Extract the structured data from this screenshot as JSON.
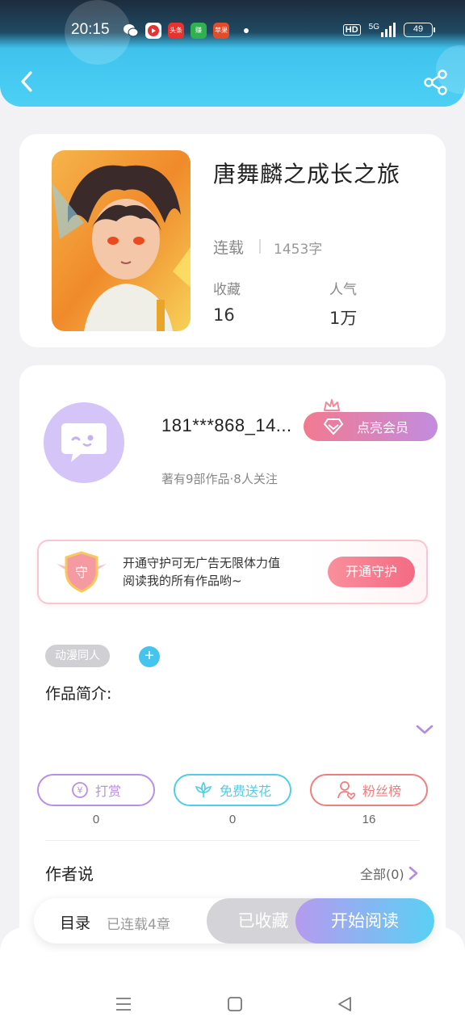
{
  "status_bar": {
    "time": "20:15",
    "network": "5G",
    "hd": "HD",
    "battery": "49",
    "apps": [
      {
        "name": "wechat-icon",
        "color": "#ffffff",
        "label": ""
      },
      {
        "name": "video-app-icon",
        "color": "#e8322f",
        "label": ""
      },
      {
        "name": "toutiao-icon",
        "color": "#e8322f",
        "label": "头条"
      },
      {
        "name": "app-icon-green",
        "color": "#2fb14f",
        "label": "赚"
      },
      {
        "name": "app-icon-red",
        "color": "#e34c2a",
        "label": "苹果"
      }
    ]
  },
  "header": {
    "accent_color": "#4dd0f4"
  },
  "book": {
    "title": "唐舞麟之成长之旅",
    "status": "连载",
    "word_count": "1453字",
    "favorites_label": "收藏",
    "favorites_value": "16",
    "popularity_label": "人气",
    "popularity_value": "1万"
  },
  "author": {
    "name": "181***868_14...",
    "summary": "著有9部作品·8人关注",
    "vip_label": "点亮会员"
  },
  "guard": {
    "badge_text": "守",
    "line1": "开通守护可无广告无限体力值",
    "line2": "阅读我的所有作品哟~",
    "button_label": "开通守护"
  },
  "tags": {
    "items": [
      "动漫同人"
    ],
    "add_label": "+"
  },
  "intro": {
    "label": "作品简介:"
  },
  "actions": [
    {
      "label": "打赏",
      "count": "0",
      "color": "#b98fe6"
    },
    {
      "label": "免费送花",
      "count": "0",
      "color": "#4fcdea"
    },
    {
      "label": "粉丝榜",
      "count": "16",
      "color": "#ef7f7f"
    }
  ],
  "author_says": {
    "label": "作者说",
    "all_label": "全部(0)"
  },
  "read_bar": {
    "toc_label": "目录",
    "chapters": "已连载4章",
    "collected_label": "已收藏",
    "start_label": "开始阅读"
  }
}
